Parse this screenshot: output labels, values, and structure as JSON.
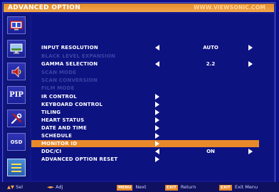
{
  "header": {
    "title": "ADVANCED OPTION",
    "url": "WWW.VIEWSONIC.COM"
  },
  "sidebar": {
    "items": [
      {
        "icon": "tv-icon"
      },
      {
        "icon": "monitor-icon"
      },
      {
        "icon": "audio-icon"
      },
      {
        "icon": "pip-icon",
        "text": "PIP"
      },
      {
        "icon": "tools-icon"
      },
      {
        "icon": "osd-icon",
        "text": "OSD"
      },
      {
        "icon": "list-icon"
      }
    ]
  },
  "menu": {
    "rows": [
      {
        "label": "INPUT RESOLUTION",
        "state": "normal",
        "value": "AUTO",
        "arrows": "both"
      },
      {
        "label": "BLACK LEVEL EXPANSION",
        "state": "disabled"
      },
      {
        "label": "GAMMA SELECTION",
        "state": "normal",
        "value": "2.2",
        "arrows": "both"
      },
      {
        "label": "SCAN MODE",
        "state": "disabled"
      },
      {
        "label": "SCAN CONVERSION",
        "state": "disabled"
      },
      {
        "label": "FILM MODE",
        "state": "disabled"
      },
      {
        "label": "IR CONTROL",
        "state": "normal",
        "arrows": "right"
      },
      {
        "label": "KEYBOARD CONTROL",
        "state": "normal",
        "arrows": "right"
      },
      {
        "label": "TILING",
        "state": "normal",
        "arrows": "right"
      },
      {
        "label": "HEART STATUS",
        "state": "normal",
        "arrows": "right"
      },
      {
        "label": "DATE AND TIME",
        "state": "normal",
        "arrows": "right"
      },
      {
        "label": "SCHEDULE",
        "state": "normal",
        "arrows": "right"
      },
      {
        "label": "MONITOR ID",
        "state": "selected",
        "arrows": "right"
      },
      {
        "label": "DDC/CI",
        "state": "normal",
        "value": "ON",
        "arrows": "both"
      },
      {
        "label": "ADVANCED OPTION RESET",
        "state": "normal",
        "arrows": "right"
      }
    ]
  },
  "footer": {
    "items": [
      {
        "key": "▲▼",
        "label": "Sel"
      },
      {
        "key": "◄►",
        "label": "Adj"
      },
      {
        "key": "MENU",
        "label": "Next"
      },
      {
        "key": "EXIT",
        "label": "Return"
      },
      {
        "key": "EXIT",
        "label": "Exit Menu"
      }
    ]
  },
  "colors": {
    "accent": "#e8892a",
    "background": "#0d1281",
    "disabled_text": "#3b44a6"
  }
}
